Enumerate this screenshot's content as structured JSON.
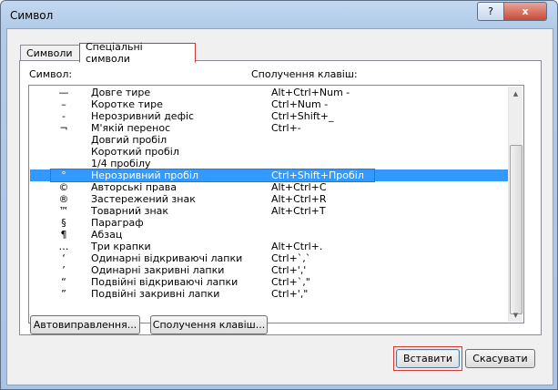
{
  "window": {
    "title": "Символ",
    "help": "?",
    "close": "x"
  },
  "tabs": [
    {
      "label": "Символи"
    },
    {
      "label": "Спеціальні символи"
    }
  ],
  "headers": {
    "symbol": "Символ:",
    "keys": "Сполучення клавіш:"
  },
  "rows": [
    {
      "sym": "—",
      "name": "Довге тире",
      "keys": "Alt+Ctrl+Num -"
    },
    {
      "sym": "–",
      "name": "Коротке тире",
      "keys": "Ctrl+Num -"
    },
    {
      "sym": "-",
      "name": "Нерозривний дефіс",
      "keys": "Ctrl+Shift+_"
    },
    {
      "sym": "¬",
      "name": "М'якій перенос",
      "keys": "Ctrl+-"
    },
    {
      "sym": "",
      "name": "Довгий пробіл",
      "keys": ""
    },
    {
      "sym": "",
      "name": "Короткий пробіл",
      "keys": ""
    },
    {
      "sym": "",
      "name": "1/4 пробілу",
      "keys": ""
    },
    {
      "sym": "°",
      "name": "Нерозривний пробіл",
      "keys": "Ctrl+Shift+Пробіл"
    },
    {
      "sym": "©",
      "name": "Авторські права",
      "keys": "Alt+Ctrl+C"
    },
    {
      "sym": "®",
      "name": "Застережений знак",
      "keys": "Alt+Ctrl+R"
    },
    {
      "sym": "™",
      "name": "Товарний знак",
      "keys": "Alt+Ctrl+T"
    },
    {
      "sym": "§",
      "name": "Параграф",
      "keys": ""
    },
    {
      "sym": "¶",
      "name": "Абзац",
      "keys": ""
    },
    {
      "sym": "…",
      "name": "Три крапки",
      "keys": "Alt+Ctrl+."
    },
    {
      "sym": "‘",
      "name": "Одинарні відкриваючі лапки",
      "keys": "Ctrl+`,`"
    },
    {
      "sym": "’",
      "name": "Одинарні закривні лапки",
      "keys": "Ctrl+','"
    },
    {
      "sym": "“",
      "name": "Подвійні відкриваючі лапки",
      "keys": "Ctrl+`,\""
    },
    {
      "sym": "”",
      "name": "Подвійні закривні лапки",
      "keys": "Ctrl+',\""
    }
  ],
  "selected_row": 7,
  "buttons": {
    "autocorrect": "Автовиправлення...",
    "shortcut": "Сполучення клавіш...",
    "insert": "Вставити",
    "cancel": "Скасувати"
  }
}
